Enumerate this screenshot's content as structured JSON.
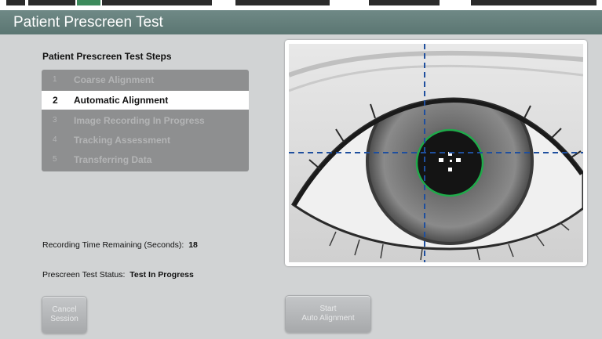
{
  "header": {
    "title": "Patient Prescreen Test"
  },
  "steps": {
    "title": "Patient Prescreen Test Steps",
    "items": [
      {
        "num": "1",
        "label": "Coarse Alignment",
        "active": false
      },
      {
        "num": "2",
        "label": "Automatic Alignment",
        "active": true
      },
      {
        "num": "3",
        "label": "Image Recording In Progress",
        "active": false
      },
      {
        "num": "4",
        "label": "Tracking Assessment",
        "active": false
      },
      {
        "num": "5",
        "label": "Transferring Data",
        "active": false
      }
    ]
  },
  "recording": {
    "label": "Recording Time Remaining (Seconds):",
    "value": "18"
  },
  "status": {
    "label": "Prescreen Test Status:",
    "value": "Test In Progress"
  },
  "buttons": {
    "cancel": {
      "line1": "Cancel",
      "line2": "Session"
    },
    "start": {
      "line1": "Start",
      "line2": "Auto Alignment"
    }
  },
  "colors": {
    "header": "#5f7a76",
    "pupil_ring": "#1faa4a",
    "crosshair": "#1f4f9e",
    "panel": "#8e8f90"
  },
  "icons": {
    "eye_image": "eye-camera-feed"
  }
}
